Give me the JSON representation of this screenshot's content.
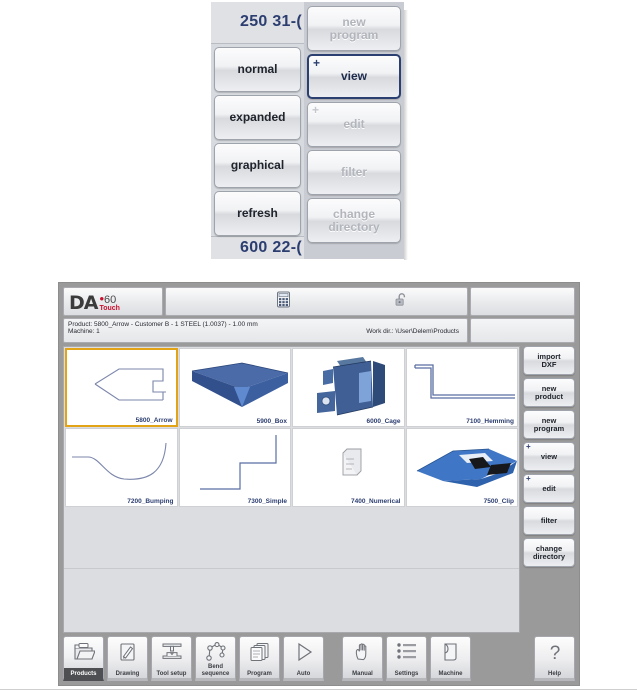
{
  "top_panel": {
    "readout_top": "250 31-(",
    "readout_bottom": "600 22-(",
    "left_buttons": [
      {
        "label": "normal",
        "state": "enabled"
      },
      {
        "label": "expanded",
        "state": "enabled"
      },
      {
        "label": "graphical",
        "state": "enabled"
      },
      {
        "label": "refresh",
        "state": "enabled"
      }
    ],
    "right_buttons": [
      {
        "label": "new\nprogram",
        "state": "disabled",
        "plus": ""
      },
      {
        "label": "view",
        "state": "focused",
        "plus": "+"
      },
      {
        "label": "edit",
        "state": "disabled",
        "plus": "+"
      },
      {
        "label": "filter",
        "state": "disabled",
        "plus": ""
      },
      {
        "label": "change\ndirectory",
        "state": "disabled",
        "plus": ""
      }
    ]
  },
  "app": {
    "logo": {
      "brand": "DA",
      "model": "60",
      "sub": "Touch",
      "dot": "•"
    },
    "header_icons": [
      {
        "name": "calculator-icon"
      },
      {
        "name": "unlock-icon"
      }
    ],
    "info": {
      "product_line": "Product: 5800_Arrow - Customer B - 1 STEEL (1.0037) - 1.00 mm",
      "machine_line": "Machine: 1",
      "workdir_line": "Work dir.: \\User\\Delem\\Products"
    },
    "products": [
      {
        "label": "5800_Arrow",
        "selected": true,
        "thumb": "arrow-profile"
      },
      {
        "label": "5900_Box",
        "selected": false,
        "thumb": "box-3d"
      },
      {
        "label": "6000_Cage",
        "selected": false,
        "thumb": "cage-3d"
      },
      {
        "label": "7100_Hemming",
        "selected": false,
        "thumb": "hemming-profile"
      },
      {
        "label": "7200_Bumping",
        "selected": false,
        "thumb": "bumping-profile"
      },
      {
        "label": "7300_Simple",
        "selected": false,
        "thumb": "simple-profile"
      },
      {
        "label": "7400_Numerical",
        "selected": false,
        "thumb": "numerical-doc"
      },
      {
        "label": "7500_Clip",
        "selected": false,
        "thumb": "clip-3d"
      }
    ],
    "sidebar": [
      {
        "label": "import\nDXF",
        "plus": ""
      },
      {
        "label": "new\nproduct",
        "plus": ""
      },
      {
        "label": "new\nprogram",
        "plus": ""
      },
      {
        "label": "view",
        "plus": "+"
      },
      {
        "label": "edit",
        "plus": "+"
      },
      {
        "label": "filter",
        "plus": ""
      },
      {
        "label": "change\ndirectory",
        "plus": ""
      }
    ],
    "nav": [
      {
        "label": "Products",
        "icon": "folder-icon",
        "active": true
      },
      {
        "label": "Drawing",
        "icon": "pencil-page-icon",
        "active": false
      },
      {
        "label": "Tool setup",
        "icon": "tool-die-icon",
        "active": false
      },
      {
        "label": "Bend\nsequence",
        "icon": "bend-sequence-icon",
        "active": false
      },
      {
        "label": "Program",
        "icon": "pages-icon",
        "active": false
      },
      {
        "label": "Auto",
        "icon": "play-icon",
        "active": false
      },
      {
        "label": "Manual",
        "icon": "hand-icon",
        "active": false
      },
      {
        "label": "Settings",
        "icon": "list-icon",
        "active": false
      },
      {
        "label": "Machine",
        "icon": "machine-page-icon",
        "active": false
      },
      {
        "label": "Help",
        "icon": "question-icon",
        "active": false
      }
    ]
  },
  "colors": {
    "selection": "#e3a317",
    "focus_border": "#2b3f70",
    "label_blue": "#2c3e70",
    "logo_red": "#c8102e",
    "window_frame": "#9a9a9a"
  }
}
